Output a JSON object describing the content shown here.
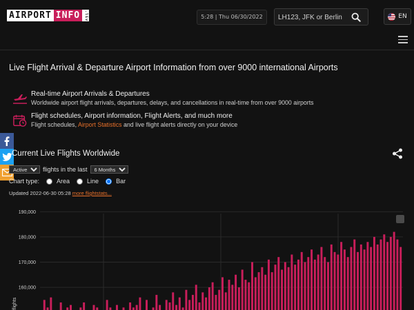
{
  "header": {
    "logo_main": "AIRPORT",
    "logo_accent": "INFO",
    "logo_small": ".live",
    "clock": "5:28 | Thu 06/30/2022",
    "search_placeholder": "LH123, JFK or Berlin",
    "language": "EN"
  },
  "page_title": "Live Flight Arrival & Departure Airport Information from over 9000 international Airports",
  "features": [
    {
      "title": "Real-time Airport Arrivals & Departures",
      "desc": "Worldwide airport flight arrivals, departures, delays, and cancellations in real-time from over 9000 airports"
    },
    {
      "title": "Flight schedules, Airport information, Flight Alerts, and much more",
      "desc_pre": "Flight schedules, ",
      "desc_link": "Airport Statistics",
      "desc_post": " and live flight alerts directly on your device"
    }
  ],
  "section_title": "Current Live Flights Worldwide",
  "controls": {
    "status_select": "Active",
    "flights_text": "flights in the last",
    "period_select": "6 Months",
    "chart_type_label": "Chart type:",
    "options": [
      "Area",
      "Line",
      "Bar"
    ],
    "selected_option": "Bar",
    "updated_text": "Updated 2022-06-30 05:28",
    "more_link": "more flightstats..."
  },
  "colors": {
    "accent": "#c81e5a",
    "link": "#e8702a",
    "bar": "#c81e5a"
  },
  "chart_data": {
    "type": "bar",
    "ylabel": "flights",
    "ylim": [
      151000,
      192000
    ],
    "yticks": [
      190000,
      180000,
      170000,
      160000
    ],
    "ytick_labels": [
      "190,000",
      "180,000",
      "170,000",
      "160,000"
    ],
    "grid": true,
    "values": [
      150000,
      155000,
      152000,
      156000,
      150000,
      151000,
      154000,
      150000,
      152000,
      153000,
      151000,
      150000,
      152000,
      154000,
      151000,
      150000,
      153000,
      152000,
      150000,
      151000,
      155000,
      152000,
      150000,
      153000,
      151000,
      152000,
      150000,
      154000,
      152000,
      153000,
      156000,
      151000,
      155000,
      150000,
      152000,
      157000,
      153000,
      151000,
      155000,
      154000,
      158000,
      153000,
      156000,
      152000,
      159000,
      155000,
      157000,
      161000,
      154000,
      158000,
      156000,
      160000,
      162000,
      157000,
      159000,
      164000,
      158000,
      163000,
      161000,
      165000,
      160000,
      167000,
      163000,
      162000,
      170000,
      164000,
      166000,
      168000,
      165000,
      171000,
      166000,
      169000,
      172000,
      167000,
      170000,
      168000,
      173000,
      169000,
      171000,
      174000,
      170000,
      172000,
      175000,
      171000,
      173000,
      176000,
      172000,
      170000,
      177000,
      174000,
      173000,
      178000,
      175000,
      172000,
      176000,
      179000,
      174000,
      177000,
      175000,
      178000,
      176000,
      180000,
      177000,
      179000,
      181000,
      178000,
      180000,
      182000,
      179000,
      176000
    ]
  }
}
